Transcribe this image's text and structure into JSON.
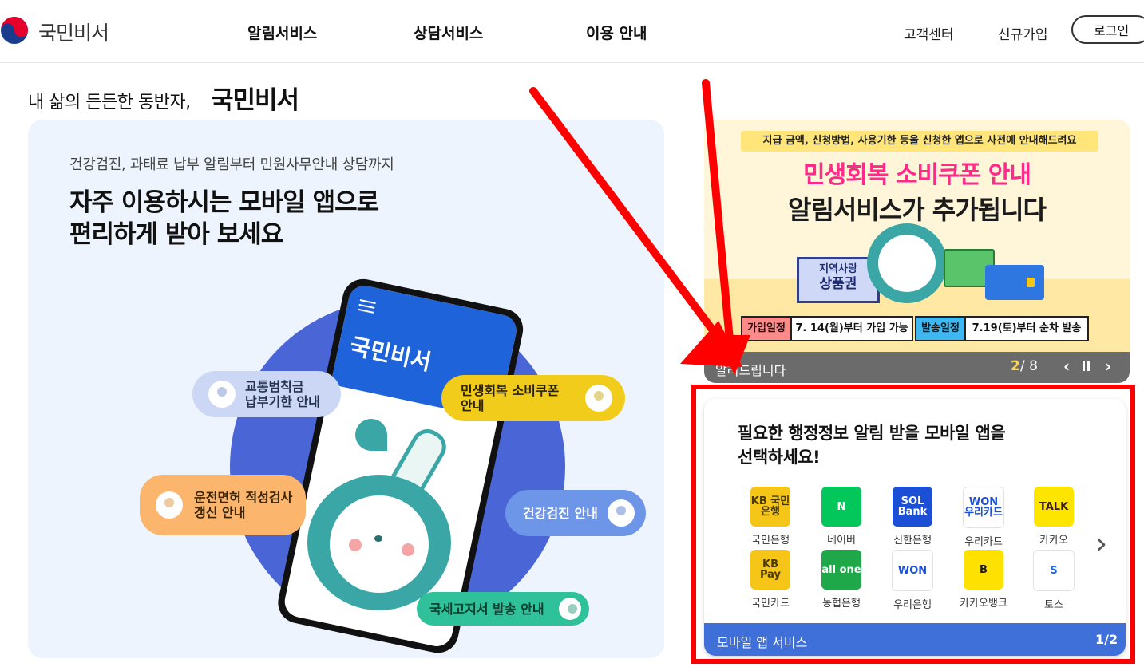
{
  "header": {
    "logo_text": "국민비서",
    "nav": [
      "알림서비스",
      "상담서비스",
      "이용 안내"
    ],
    "util": [
      "고객센터",
      "신규가입"
    ],
    "login_label": "로그인"
  },
  "tagline": {
    "small": "내 삶의 든든한 동반자,",
    "big": "국민비서"
  },
  "hero": {
    "subtitle": "건강검진, 과태료 납부 알림부터 민원사무안내 상담까지",
    "title_line1": "자주 이용하시는 모바일 앱으로",
    "title_line2": "편리하게 받아 보세요",
    "phone_title": "국민비서",
    "bubbles": [
      "교통범칙금\n납부기한 안내",
      "민생회복 소비쿠폰\n안내",
      "운전면허 적성검사\n갱신 안내",
      "건강검진 안내",
      "국세고지서 발송 안내"
    ]
  },
  "banner": {
    "top_text": "지급 금액, 신청방법, 사용기한 등을 신청한 앱으로 사전에 안내해드려요",
    "headline1": "민생회복 소비쿠폰 안내",
    "headline2": "알림서비스가 추가됩니다",
    "voucher_line1": "지역사랑",
    "voucher_line2": "상품권",
    "join_label": "가입일정",
    "join_value": "7. 14(월)부터 가입 가능",
    "send_label": "발송일정",
    "send_value": "7.19(토)부터 순차 발송",
    "bar_label": "알려드립니다",
    "page_current": "2",
    "page_total": "/ 8"
  },
  "apps_panel": {
    "title": "필요한 행정정보 알림 받을 모바일 앱을\n선택하세요!",
    "apps": [
      {
        "name": "국민은행",
        "icon_text": "KB 국민은행",
        "bg": "#f5c518",
        "fg": "#4a3a00"
      },
      {
        "name": "네이버",
        "icon_text": "N",
        "bg": "#03c75a",
        "fg": "#ffffff"
      },
      {
        "name": "신한은행",
        "icon_text": "SOL Bank",
        "bg": "#1a4fd6",
        "fg": "#ffffff"
      },
      {
        "name": "우리카드",
        "icon_text": "WON 우리카드",
        "bg": "#ffffff",
        "fg": "#1a4fd6"
      },
      {
        "name": "카카오",
        "icon_text": "TALK",
        "bg": "#fee500",
        "fg": "#3a1d1d"
      },
      {
        "name": "국민카드",
        "icon_text": "KB Pay",
        "bg": "#f5c518",
        "fg": "#4a3a00"
      },
      {
        "name": "농협은행",
        "icon_text": "all one",
        "bg": "#1ea84a",
        "fg": "#ffffff"
      },
      {
        "name": "우리은행",
        "icon_text": "WON",
        "bg": "#ffffff",
        "fg": "#1a4fd6"
      },
      {
        "name": "카카오뱅크",
        "icon_text": "B",
        "bg": "#ffe100",
        "fg": "#1b1b1b"
      },
      {
        "name": "토스",
        "icon_text": "S",
        "bg": "#ffffff",
        "fg": "#1c64f2"
      }
    ],
    "bar_label": "모바일 앱 서비스",
    "page": "1/2"
  }
}
